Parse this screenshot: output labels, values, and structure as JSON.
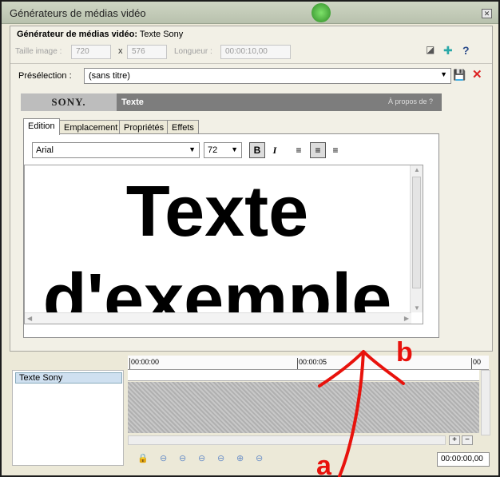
{
  "window": {
    "title": "Générateurs de médias vidéo",
    "close_label": "✕"
  },
  "generator": {
    "label_prefix": "Générateur de médias vidéo:",
    "name": "Texte Sony"
  },
  "dims": {
    "image_size_label": "Taille image :",
    "width": "720",
    "x": "x",
    "height": "576",
    "length_label": "Longueur :",
    "length": "00:00:10,00"
  },
  "preset": {
    "label": "Présélection :",
    "value": "(sans titre)"
  },
  "plugin": {
    "brand": "SONY.",
    "name": "Texte",
    "about": "À propos de   ?"
  },
  "tabs": [
    {
      "label": "Edition"
    },
    {
      "label": "Emplacement"
    },
    {
      "label": "Propriétés"
    },
    {
      "label": "Effets"
    }
  ],
  "format": {
    "font": "Arial",
    "size": "72",
    "bold": "B",
    "italic": "I"
  },
  "editor": {
    "line1": "Texte",
    "line2": "d'exemple"
  },
  "timeline": {
    "track_name": "Texte Sony",
    "ruler_start": "00:00:00",
    "ruler_mid": "00:00:05",
    "ruler_end": "00",
    "timecode": "00:00:00,00"
  },
  "annotations": {
    "label_a": "a",
    "label_b": "b",
    "color": "#e8120c"
  }
}
